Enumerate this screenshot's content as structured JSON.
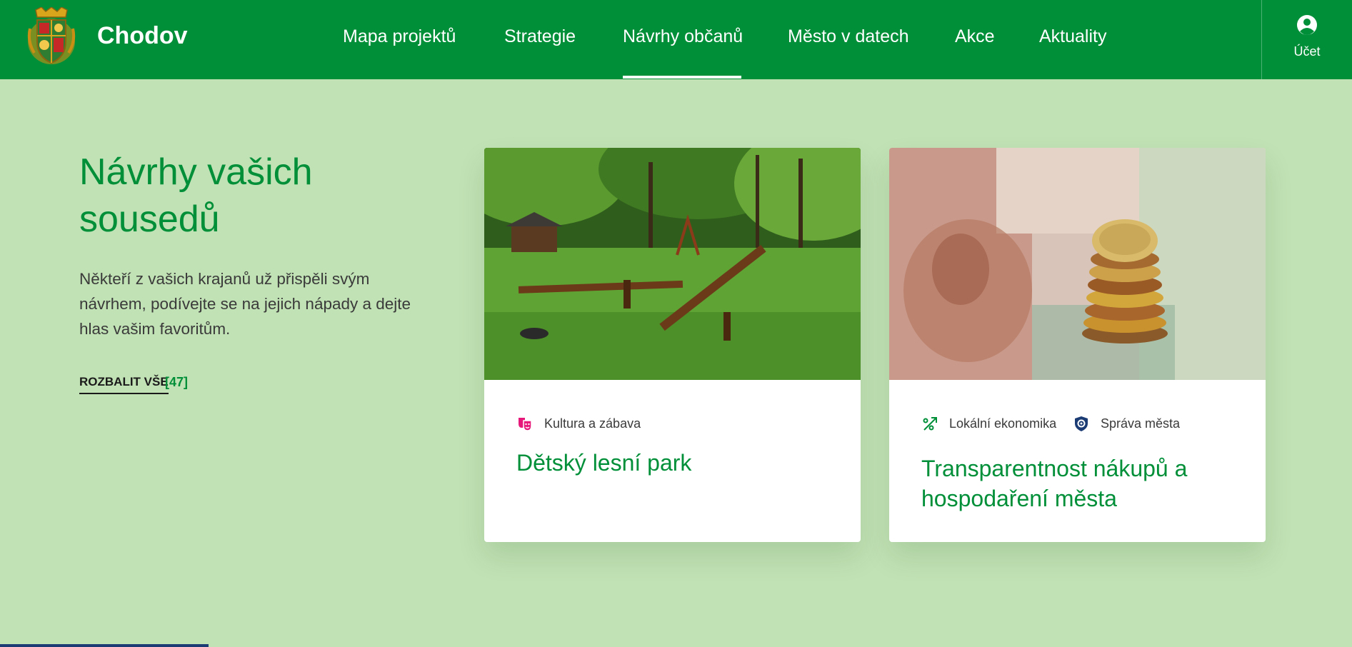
{
  "header": {
    "site_title": "Chodov",
    "nav": [
      {
        "label": "Mapa projektů"
      },
      {
        "label": "Strategie"
      },
      {
        "label": "Návrhy občanů",
        "active": true
      },
      {
        "label": "Město v datech"
      },
      {
        "label": "Akce"
      },
      {
        "label": "Aktuality"
      }
    ],
    "account_label": "Účet"
  },
  "intro": {
    "title": "Návrhy vašich sousedů",
    "text": "Někteří z vašich krajanů už přispěli svým návrhem, podívejte se na jejich nápady a dejte hlas vašim favoritům.",
    "expand_label": "ROZBALIT VŠE",
    "expand_count": "[47]"
  },
  "cards": [
    {
      "tags": [
        {
          "icon": "theater-masks-icon",
          "label": "Kultura a zábava",
          "color": "#e6197a"
        }
      ],
      "title": "Dětský lesní park"
    },
    {
      "tags": [
        {
          "icon": "percent-arrow-icon",
          "label": "Lokální ekonomika",
          "color": "#008f39"
        },
        {
          "icon": "gear-shield-icon",
          "label": "Správa města",
          "color": "#1a3b73"
        }
      ],
      "title": "Transparentnost nákupů a hospodaření města"
    }
  ],
  "colors": {
    "brand_green": "#008f39",
    "page_background": "#c1e2b4"
  }
}
